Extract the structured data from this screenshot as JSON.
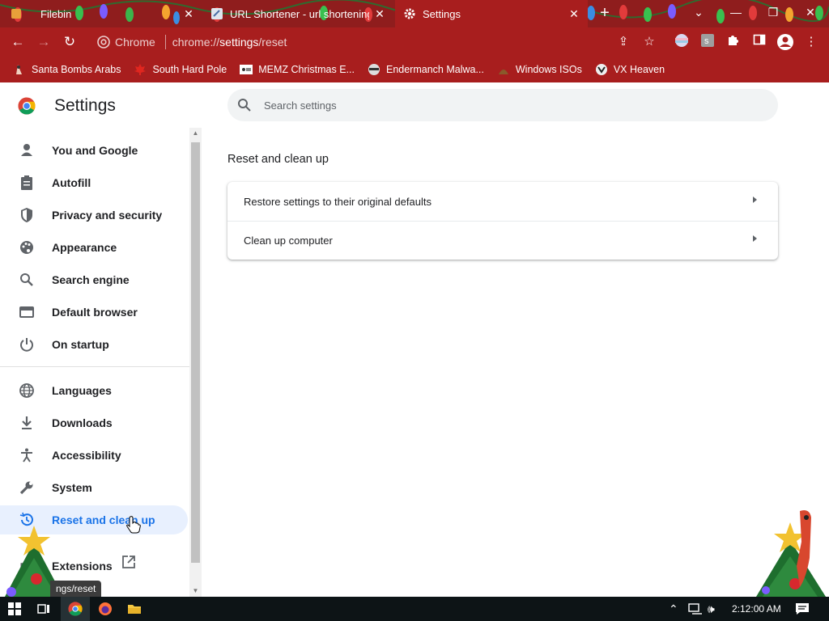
{
  "tabs": [
    {
      "title": "Filebin",
      "active": false,
      "icon": "filebin-favicon"
    },
    {
      "title": "URL Shortener - url shortening s",
      "active": false,
      "icon": "page-favicon"
    },
    {
      "title": "Settings",
      "active": true,
      "icon": "gear-icon"
    }
  ],
  "omnibox": {
    "chip": "Chrome",
    "url_prefix": "chrome://",
    "url_host": "settings",
    "url_path": "/reset"
  },
  "bookmarks": [
    {
      "label": "Santa Bombs Arabs",
      "icon": "santa-icon"
    },
    {
      "label": "South Hard Pole",
      "icon": "maple-leaf-icon"
    },
    {
      "label": "MEMZ Christmas E...",
      "icon": "memz-icon"
    },
    {
      "label": "Endermanch Malwa...",
      "icon": "raccoon-icon"
    },
    {
      "label": "Windows ISOs",
      "icon": "poop-icon"
    },
    {
      "label": "VX Heaven",
      "icon": "vx-icon"
    }
  ],
  "settings": {
    "title": "Settings",
    "search_placeholder": "Search settings",
    "nav": [
      {
        "label": "You and Google",
        "icon": "person-icon"
      },
      {
        "label": "Autofill",
        "icon": "clipboard-icon"
      },
      {
        "label": "Privacy and security",
        "icon": "shield-icon"
      },
      {
        "label": "Appearance",
        "icon": "palette-icon"
      },
      {
        "label": "Search engine",
        "icon": "search-icon"
      },
      {
        "label": "Default browser",
        "icon": "browser-icon"
      },
      {
        "label": "On startup",
        "icon": "power-icon"
      },
      {
        "label": "Languages",
        "icon": "globe-icon"
      },
      {
        "label": "Downloads",
        "icon": "download-icon"
      },
      {
        "label": "Accessibility",
        "icon": "accessibility-icon"
      },
      {
        "label": "System",
        "icon": "wrench-icon"
      },
      {
        "label": "Reset and clean up",
        "icon": "history-icon",
        "selected": true
      },
      {
        "label": "Extensions",
        "icon": "puzzle-icon"
      }
    ],
    "section_title": "Reset and clean up",
    "rows": [
      {
        "label": "Restore settings to their original defaults"
      },
      {
        "label": "Clean up computer"
      }
    ],
    "status_tooltip": "ngs/reset"
  },
  "taskbar": {
    "time": "2:12:00 AM"
  },
  "colors": {
    "frame": "#8f1d1d",
    "toolbar": "#a81e1e",
    "accent": "#1a73e8",
    "selected_bg": "#e8f0fe"
  }
}
